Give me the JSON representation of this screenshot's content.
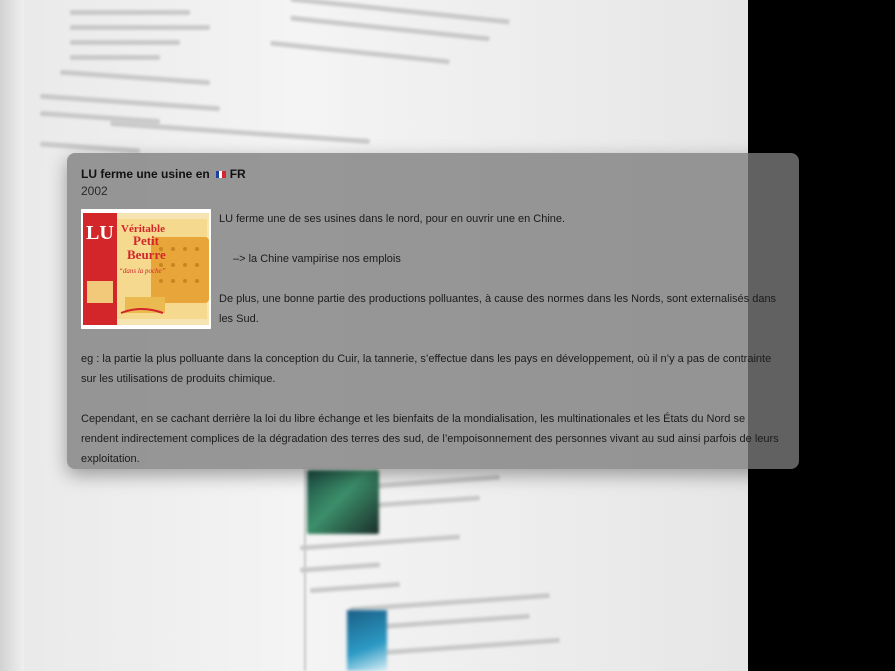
{
  "popup": {
    "title": "LU ferme une usine en",
    "country": "FR",
    "year": "2002",
    "paragraphs": [
      "LU ferme une de ses usines dans le nord, pour en ouvrir une en Chine.",
      "–> la Chine vampirise nos emplois",
      "De plus, une bonne partie des productions polluantes, à cause des normes dans les Nords, sont externalisés dans les Sud.",
      "eg : la partie la plus polluante dans la conception du Cuir, la tannerie, s’effectue dans les pays en développement, où il n’y a pas de contrainte sur les utilisations de produits chimique.",
      "Cependant, en se cachant derrière la loi du libre échange et les bienfaits de la mondialisation, les multinationales et les États du Nord se rendent indirectement complices de la dégradation des terres des sud, de l’empoisonnement des personnes vivant au sud ainsi parfois de leurs exploitation."
    ],
    "image": {
      "brand": "LU",
      "line1": "Véritable",
      "line2": "Petit",
      "line3": "Beurre",
      "tagline": "“dans la poche”"
    }
  },
  "colors": {
    "overlay": "#7c7c7c",
    "lu_red": "#d2262b",
    "biscuit": "#e8a53a"
  }
}
